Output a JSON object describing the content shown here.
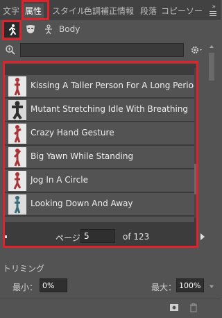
{
  "tabs": [
    {
      "label": "文字"
    },
    {
      "label": "属性",
      "active": true
    },
    {
      "label": "スタイル"
    },
    {
      "label": "色調補正"
    },
    {
      "label": "情報"
    },
    {
      "label": "段落"
    },
    {
      "label": "コピーソー"
    }
  ],
  "subtoolbar": {
    "body_label": "Body",
    "icons": [
      "running-figure-icon",
      "mask-icon",
      "figure-pose-icon"
    ]
  },
  "search": {
    "value": "",
    "placeholder": ""
  },
  "animations": [
    {
      "label": "Kissing A Taller Person For A Long Period",
      "thumb": "red-figure"
    },
    {
      "label": "Mutant Stretching Idle With Breathing",
      "thumb": "dark-figure"
    },
    {
      "label": "Crazy Hand Gesture",
      "thumb": "red-figure"
    },
    {
      "label": "Big Yawn While Standing",
      "thumb": "red-figure"
    },
    {
      "label": "Jog In A Circle",
      "thumb": "red-figure"
    },
    {
      "label": "Looking Down And Away",
      "thumb": "teal-figure"
    }
  ],
  "pager": {
    "label": "ページ",
    "current": "5",
    "of_text": "of 123"
  },
  "trimming": {
    "title": "トリミング",
    "min_label": "最小：",
    "min_value": "0%",
    "max_label": "最大：",
    "max_value": "100%"
  },
  "colors": {
    "panel_bg": "#535353",
    "highlight": "#e3212b",
    "tab_bg": "#424242"
  }
}
